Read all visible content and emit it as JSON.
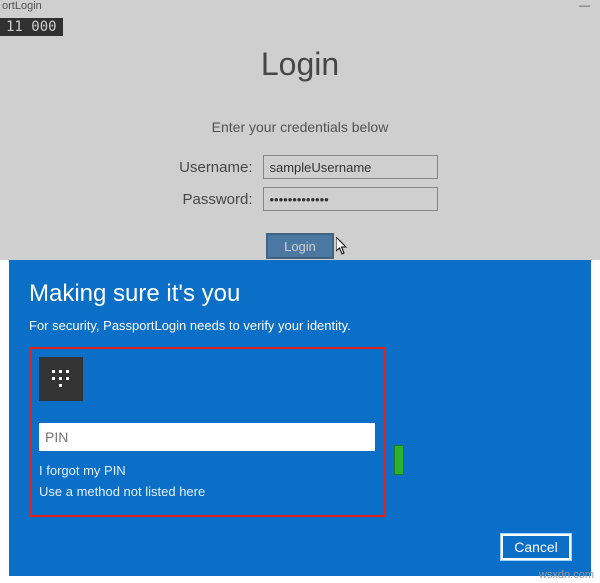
{
  "titlebar": {
    "title": "ortLogin",
    "dash": "—"
  },
  "counters": "11  000",
  "login": {
    "heading": "Login",
    "subtitle": "Enter your credentials below",
    "username_label": "Username:",
    "username_value": "sampleUsername",
    "password_label": "Password:",
    "password_value": "•••••••••••••",
    "button": "Login"
  },
  "dialog": {
    "title": "Making sure it's you",
    "subtitle": "For security, PassportLogin needs to verify your identity.",
    "pin_placeholder": "PIN",
    "forgot_link": "I forgot my PIN",
    "alt_method_link": "Use a method not listed here",
    "cancel": "Cancel"
  },
  "watermark": "wsxdn.com"
}
